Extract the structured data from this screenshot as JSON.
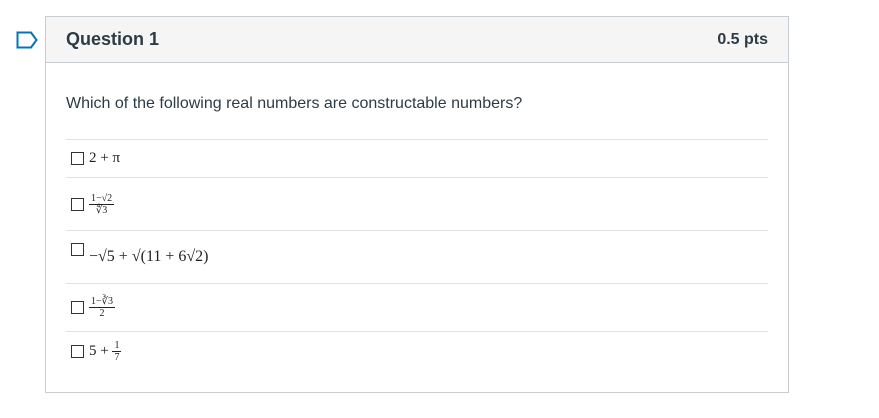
{
  "question": {
    "title": "Question 1",
    "points": "0.5 pts",
    "prompt": "Which of the following real numbers are constructable numbers?"
  },
  "answers": [
    {
      "id": "a1",
      "math": "2 + π"
    },
    {
      "id": "a2",
      "math_num": "1−√2",
      "math_den": "∜3"
    },
    {
      "id": "a3",
      "math": "−√5 + √(11 + 6√2)"
    },
    {
      "id": "a4",
      "math_num": "1−∛3",
      "math_den": "2"
    },
    {
      "id": "a5",
      "math_prefix": "5 + ",
      "math_num": "1",
      "math_den": "7"
    }
  ],
  "colors": {
    "border": "#c7cdd1",
    "header_bg": "#f5f5f5",
    "flag": "#0374b5"
  },
  "icons": {
    "flag": "bookmark-flag-icon"
  }
}
